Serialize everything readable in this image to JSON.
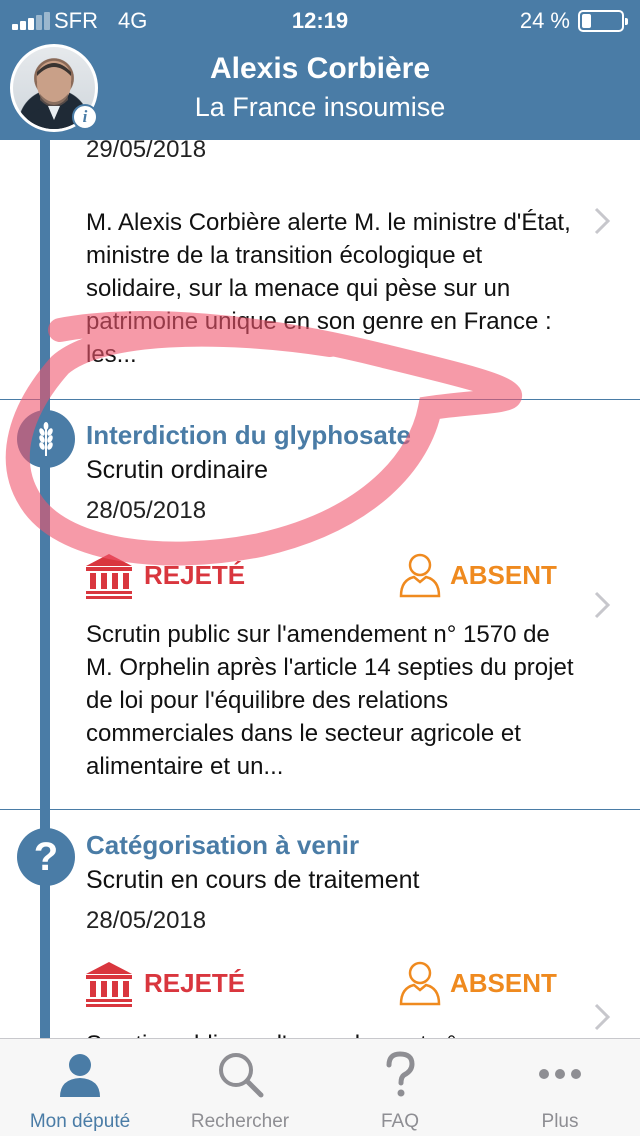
{
  "status_bar": {
    "carrier": "SFR",
    "network": "4G",
    "time": "12:19",
    "battery_percent": "24 %"
  },
  "header": {
    "name": "Alexis Corbière",
    "party": "La France insoumise",
    "info_badge": "i"
  },
  "timeline": [
    {
      "date": "29/05/2018",
      "description": "M. Alexis Corbière alerte M. le ministre d'État, ministre de la transition écologique et solidaire, sur la menace qui pèse sur un patrimoine unique en son genre en France : les..."
    },
    {
      "title": "Interdiction du glyphosate",
      "subtitle": "Scrutin ordinaire",
      "date": "28/05/2018",
      "result": "REJETÉ",
      "presence": "ABSENT",
      "description": "Scrutin public sur l'amendement n° 1570 de M. Orphelin après l'article 14 septies du projet de loi pour l'équilibre des relations commerciales dans le secteur agricole et alimentaire et un...",
      "icon": "wheat-icon"
    },
    {
      "title": "Catégorisation à venir",
      "subtitle": "Scrutin en cours de traitement",
      "date": "28/05/2018",
      "result": "REJETÉ",
      "presence": "ABSENT",
      "description": "Scrutin public sur l'amendement n°",
      "icon": "question-mark",
      "marker_text": "?"
    }
  ],
  "tabbar": {
    "tabs": [
      {
        "label": "Mon député",
        "icon": "person-icon",
        "active": true
      },
      {
        "label": "Rechercher",
        "icon": "search-icon",
        "active": false
      },
      {
        "label": "FAQ",
        "icon": "question-icon",
        "active": false
      },
      {
        "label": "Plus",
        "icon": "more-icon",
        "active": false
      }
    ]
  },
  "colors": {
    "primary": "#4a7ca6",
    "rejected": "#d9363e",
    "absent": "#ef8a1f",
    "annotation": "#f0566e"
  }
}
